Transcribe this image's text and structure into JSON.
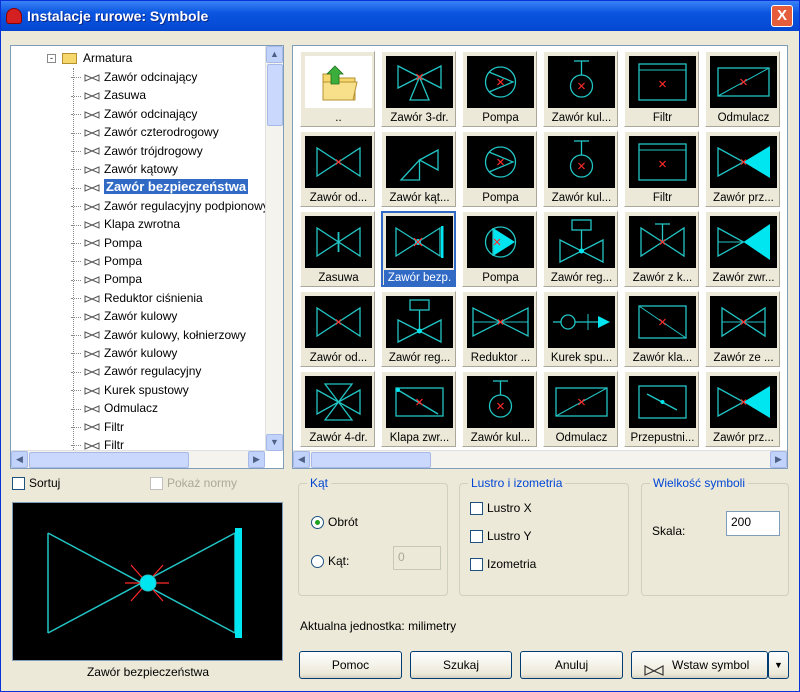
{
  "window": {
    "title": "Instalacje rurowe: Symbole",
    "close_label": "X"
  },
  "tree": {
    "root": {
      "expander": "-",
      "label": "Armatura"
    },
    "items": [
      {
        "label": "Zawór odcinający",
        "selected": false
      },
      {
        "label": "Zasuwa",
        "selected": false
      },
      {
        "label": "Zawór odcinający",
        "selected": false
      },
      {
        "label": "Zawór czterodrogowy",
        "selected": false
      },
      {
        "label": "Zawór trójdrogowy",
        "selected": false
      },
      {
        "label": "Zawór kątowy",
        "selected": false
      },
      {
        "label": "Zawór bezpieczeństwa",
        "selected": true
      },
      {
        "label": "Zawór regulacyjny podpionowy",
        "selected": false
      },
      {
        "label": "Klapa zwrotna",
        "selected": false
      },
      {
        "label": "Pompa",
        "selected": false
      },
      {
        "label": "Pompa",
        "selected": false
      },
      {
        "label": "Pompa",
        "selected": false
      },
      {
        "label": "Reduktor ciśnienia",
        "selected": false
      },
      {
        "label": "Zawór kulowy",
        "selected": false
      },
      {
        "label": "Zawór kulowy, kołnierzowy",
        "selected": false
      },
      {
        "label": "Zawór kulowy",
        "selected": false
      },
      {
        "label": "Zawór regulacyjny",
        "selected": false
      },
      {
        "label": "Kurek spustowy",
        "selected": false
      },
      {
        "label": "Odmulacz",
        "selected": false
      },
      {
        "label": "Filtr",
        "selected": false
      },
      {
        "label": "Filtr",
        "selected": false
      }
    ],
    "scroll_up": "▲",
    "scroll_down": "▼",
    "scroll_left": "◀",
    "scroll_right": "▶"
  },
  "symbols": [
    {
      "label": "..",
      "icon": "up-folder-icon",
      "selected": false
    },
    {
      "label": "Zawór 3-dr.",
      "icon": "three-way-valve-icon",
      "selected": false
    },
    {
      "label": "Pompa",
      "icon": "pump-icon",
      "selected": false
    },
    {
      "label": "Zawór kul...",
      "icon": "ball-valve-icon",
      "selected": false
    },
    {
      "label": "Filtr",
      "icon": "filter-icon",
      "selected": false
    },
    {
      "label": "Odmulacz",
      "icon": "sludge-separator-icon",
      "selected": false
    },
    {
      "label": "Zawór od...",
      "icon": "shutoff-valve-icon",
      "selected": false
    },
    {
      "label": "Zawór kąt...",
      "icon": "angle-valve-icon",
      "selected": false
    },
    {
      "label": "Pompa",
      "icon": "pump-icon",
      "selected": false
    },
    {
      "label": "Zawór kul...",
      "icon": "ball-valve-icon",
      "selected": false
    },
    {
      "label": "Filtr",
      "icon": "filter-icon",
      "selected": false
    },
    {
      "label": "Zawór prz...",
      "icon": "flow-valve-icon",
      "selected": false
    },
    {
      "label": "Zasuwa",
      "icon": "gate-valve-icon",
      "selected": false
    },
    {
      "label": "Zawór bezp.",
      "icon": "safety-valve-icon",
      "selected": true
    },
    {
      "label": "Pompa",
      "icon": "pump-filled-icon",
      "selected": false
    },
    {
      "label": "Zawór reg...",
      "icon": "control-valve-icon",
      "selected": false
    },
    {
      "label": "Zawór z k...",
      "icon": "valve-with-cap-icon",
      "selected": false
    },
    {
      "label": "Zawór zwr...",
      "icon": "check-valve-icon",
      "selected": false
    },
    {
      "label": "Zawór od...",
      "icon": "shutoff-valve-icon",
      "selected": false
    },
    {
      "label": "Zawór reg...",
      "icon": "control-valve-icon",
      "selected": false
    },
    {
      "label": "Reduktor ...",
      "icon": "pressure-reducer-icon",
      "selected": false
    },
    {
      "label": "Kurek spu...",
      "icon": "drain-cock-icon",
      "selected": false
    },
    {
      "label": "Zawór kla...",
      "icon": "flap-valve-icon",
      "selected": false
    },
    {
      "label": "Zawór ze ...",
      "icon": "valve-icon",
      "selected": false
    },
    {
      "label": "Zawór 4-dr.",
      "icon": "four-way-valve-icon",
      "selected": false
    },
    {
      "label": "Klapa zwr...",
      "icon": "check-flap-icon",
      "selected": false
    },
    {
      "label": "Zawór kul...",
      "icon": "ball-valve-icon",
      "selected": false
    },
    {
      "label": "Odmulacz",
      "icon": "sludge-separator-icon",
      "selected": false
    },
    {
      "label": "Przepustni...",
      "icon": "throttle-icon",
      "selected": false
    },
    {
      "label": "Zawór prz...",
      "icon": "flow-valve-icon",
      "selected": false
    }
  ],
  "options": {
    "sort_label": "Sortuj",
    "show_standards_label": "Pokaż normy",
    "angle": {
      "title": "Kąt",
      "rotation_label": "Obrót",
      "angle_label": "Kąt:",
      "angle_value": "0"
    },
    "mirror": {
      "title": "Lustro i izometria",
      "mirror_x": "Lustro X",
      "mirror_y": "Lustro Y",
      "isometry": "Izometria"
    },
    "size": {
      "title": "Wielkość symboli",
      "scale_label": "Skala:",
      "scale_value": "200"
    },
    "unit_text": "Aktualna jednostka: milimetry"
  },
  "preview": {
    "caption": "Zawór bezpieczeństwa"
  },
  "buttons": {
    "help": "Pomoc",
    "search": "Szukaj",
    "cancel": "Anuluj",
    "insert": "Wstaw symbol",
    "dropdown": "▼"
  },
  "colors": {
    "symbol": "#22c4c4",
    "symbol_fill": "#00e6f0",
    "marker": "#ff2a2a",
    "selection": "#316ac5"
  }
}
